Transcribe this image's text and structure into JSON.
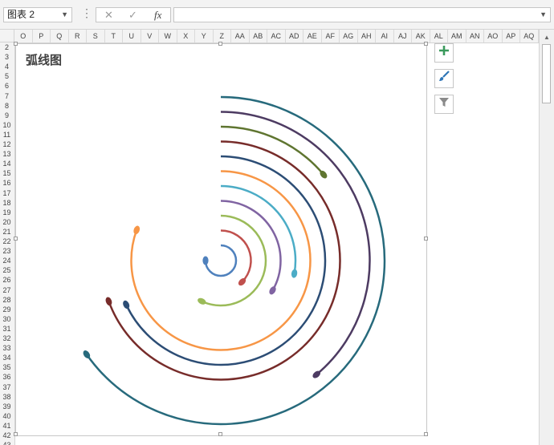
{
  "formula_bar": {
    "name_box": "图表 2",
    "fx_label": "fx",
    "formula": ""
  },
  "columns": [
    "O",
    "P",
    "Q",
    "R",
    "S",
    "T",
    "U",
    "V",
    "W",
    "X",
    "Y",
    "Z",
    "AA",
    "AB",
    "AC",
    "AD",
    "AE",
    "AF",
    "AG",
    "AH",
    "AI",
    "AJ",
    "AK",
    "AL",
    "AM",
    "AN",
    "AO",
    "AP",
    "AQ"
  ],
  "rows": [
    "2",
    "3",
    "4",
    "5",
    "6",
    "7",
    "8",
    "9",
    "10",
    "11",
    "12",
    "13",
    "14",
    "15",
    "16",
    "17",
    "18",
    "19",
    "20",
    "21",
    "22",
    "23",
    "24",
    "25",
    "26",
    "27",
    "28",
    "29",
    "30",
    "31",
    "32",
    "33",
    "34",
    "35",
    "36",
    "37",
    "38",
    "39",
    "40",
    "41",
    "42",
    "43"
  ],
  "chart": {
    "title": "弧线图"
  },
  "chart_data": {
    "type": "arc",
    "title": "弧线图",
    "series": [
      {
        "color": "#4f81bd",
        "sweep_deg": 270
      },
      {
        "color": "#c0504d",
        "sweep_deg": 135
      },
      {
        "color": "#9bbb59",
        "sweep_deg": 205
      },
      {
        "color": "#8064a2",
        "sweep_deg": 120
      },
      {
        "color": "#4bacc6",
        "sweep_deg": 100
      },
      {
        "color": "#f79646",
        "sweep_deg": 290
      },
      {
        "color": "#2c4d75",
        "sweep_deg": 245
      },
      {
        "color": "#772c2a",
        "sweep_deg": 250
      },
      {
        "color": "#5f7530",
        "sweep_deg": 50
      },
      {
        "color": "#4d3b62",
        "sweep_deg": 140
      },
      {
        "color": "#276a7c",
        "sweep_deg": 235
      }
    ]
  },
  "side_buttons": [
    "add-chart-element",
    "chart-styles",
    "chart-filters"
  ]
}
